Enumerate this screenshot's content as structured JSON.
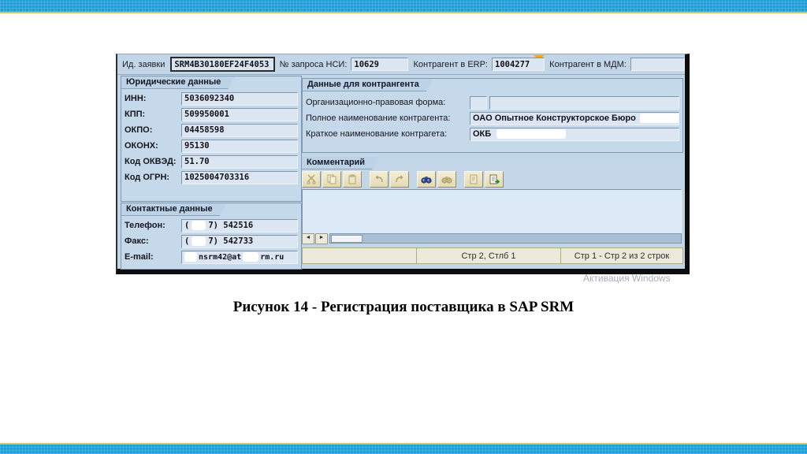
{
  "slide": {
    "caption": "Рисунок 14 - Регистрация поставщика в SAP SRM",
    "watermark": "Активация Windows"
  },
  "colors": {
    "bar_blue": "#1e9fd9",
    "bar_gold": "#d6c26e",
    "sap_background": "#c3d6e8",
    "field_background": "#dbe6f2",
    "status_bar": "#ece9d8",
    "marker_orange": "#f0a426"
  },
  "header": {
    "request_id_label": "Ид. заявки",
    "request_id_value": "SRM4B30180EF24F4053",
    "nsi_label": "№ запроса НСИ:",
    "nsi_value": "10629",
    "erp_label": "Контрагент в ERP:",
    "erp_value": "1004277",
    "mdm_label": "Контрагент в МДМ:",
    "mdm_value": ""
  },
  "legal": {
    "title": "Юридические данные",
    "fields": [
      {
        "label": "ИНН:",
        "value": "5036092340"
      },
      {
        "label": "КПП:",
        "value": "509950001"
      },
      {
        "label": "ОКПО:",
        "value": "04458598"
      },
      {
        "label": "ОКОНХ:",
        "value": "95130"
      },
      {
        "label": "Код ОКВЭД:",
        "value": "51.70"
      },
      {
        "label": "Код ОГРН:",
        "value": "1025004703316"
      }
    ]
  },
  "contacts": {
    "title": "Контактные данные",
    "phone_label": "Телефон:",
    "phone_prefix": "(",
    "phone_value": "7) 542516",
    "fax_label": "Факс:",
    "fax_prefix": "(",
    "fax_value": "7) 542733",
    "email_label": "E-mail:",
    "email_user": "nsrm42@at",
    "email_domain": "rm.ru"
  },
  "counterparty": {
    "title": "Данные для контрангента",
    "legal_form_label": "Организационно-правовая форма:",
    "legal_form_value": "",
    "full_name_label": "Полное наименование контрагента:",
    "full_name_value": "ОАО Опытное Конструкторское Бюро",
    "short_name_label": "Краткое наименование контрагета:",
    "short_name_value": "ОКБ"
  },
  "comment": {
    "title": "Комментарий",
    "toolbar_icons": [
      "cut",
      "copy",
      "paste",
      "undo",
      "redo",
      "find",
      "find-next",
      "document",
      "insert-file"
    ],
    "scroll_left_icon": "◄",
    "scroll_right_icon": "►",
    "status_center": "Стр 2, Стлб 1",
    "status_right": "Стр 1 - Стр 2 из 2 строк"
  }
}
